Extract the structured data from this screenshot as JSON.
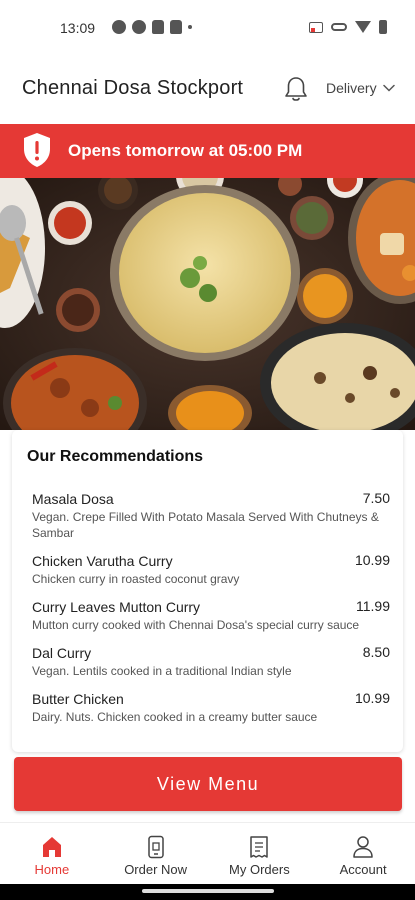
{
  "status_bar": {
    "time": "13:09"
  },
  "header": {
    "restaurant_name": "Chennai Dosa Stockport",
    "mode": "Delivery"
  },
  "banner": {
    "text": "Opens tomorrow at 05:00 PM"
  },
  "recommendations": {
    "title": "Our Recommendations",
    "items": [
      {
        "name": "Masala Dosa",
        "price": "7.50",
        "description": "Vegan. Crepe Filled With Potato Masala Served With Chutneys & Sambar"
      },
      {
        "name": "Chicken Varutha Curry",
        "price": "10.99",
        "description": "Chicken curry in roasted coconut gravy"
      },
      {
        "name": "Curry Leaves Mutton Curry",
        "price": "11.99",
        "description": "Mutton curry cooked with Chennai Dosa's special curry sauce"
      },
      {
        "name": "Dal Curry",
        "price": "8.50",
        "description": "Vegan. Lentils cooked in a traditional Indian style"
      },
      {
        "name": "Butter Chicken",
        "price": "10.99",
        "description": "Dairy. Nuts. Chicken cooked in a creamy butter sauce"
      }
    ]
  },
  "cta": {
    "label": "View Menu"
  },
  "bottom_nav": {
    "items": [
      {
        "label": "Home",
        "icon": "home-icon",
        "active": true
      },
      {
        "label": "Order Now",
        "icon": "phone-order-icon"
      },
      {
        "label": "My Orders",
        "icon": "receipt-icon"
      },
      {
        "label": "Account",
        "icon": "person-icon"
      }
    ]
  },
  "colors": {
    "accent": "#e53935"
  }
}
